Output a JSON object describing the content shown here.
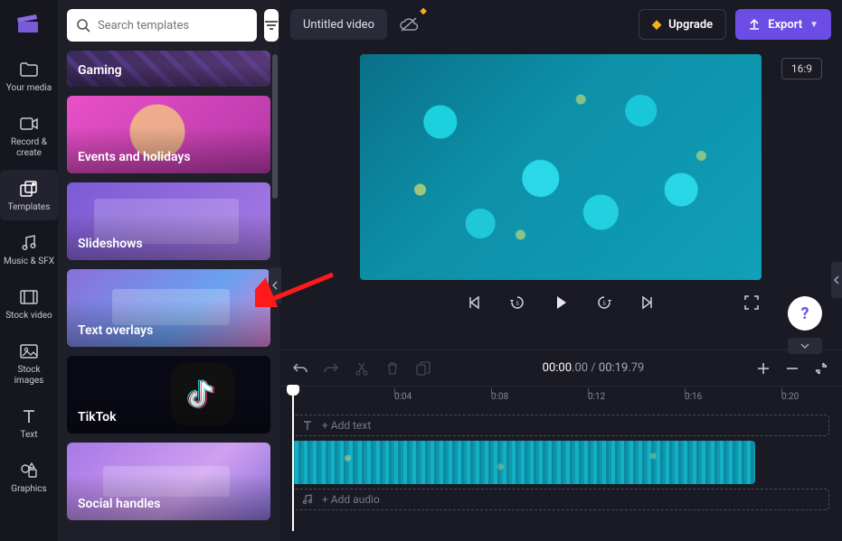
{
  "brand": {
    "name": "Clipchamp"
  },
  "nav": {
    "items": [
      {
        "label": "Your media",
        "icon": "folder-icon"
      },
      {
        "label": "Record & create",
        "icon": "camera-icon"
      },
      {
        "label": "Templates",
        "icon": "templates-icon",
        "active": true
      },
      {
        "label": "Music & SFX",
        "icon": "music-icon"
      },
      {
        "label": "Stock video",
        "icon": "film-icon"
      },
      {
        "label": "Stock images",
        "icon": "image-icon"
      },
      {
        "label": "Text",
        "icon": "text-icon"
      },
      {
        "label": "Graphics",
        "icon": "graphics-icon"
      }
    ]
  },
  "search": {
    "placeholder": "Search templates"
  },
  "templates": [
    {
      "label": "Gaming",
      "style": "tc-gaming"
    },
    {
      "label": "Events and holidays",
      "style": "tc-events"
    },
    {
      "label": "Slideshows",
      "style": "tc-slide"
    },
    {
      "label": "Text overlays",
      "style": "tc-text"
    },
    {
      "label": "TikTok",
      "style": "tc-tiktok"
    },
    {
      "label": "Social handles",
      "style": "tc-social"
    }
  ],
  "project": {
    "title": "Untitled video"
  },
  "actions": {
    "upgrade": "Upgrade",
    "export": "Export"
  },
  "aspect": {
    "label": "16:9"
  },
  "timecode": {
    "current": "00:00",
    "current_sub": ".00",
    "sep": " / ",
    "total": "00:19",
    "total_sub": ".79"
  },
  "ruler": {
    "ticks": [
      "0:04",
      "0:08",
      "0:12",
      "0:16",
      "0:20"
    ]
  },
  "tracks": {
    "text_hint": "+ Add text",
    "audio_hint": "+ Add audio"
  },
  "help": {
    "label": "?"
  }
}
